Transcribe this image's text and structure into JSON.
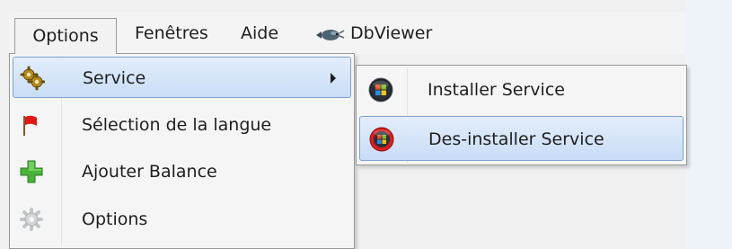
{
  "menubar": {
    "items": [
      {
        "label": "Options",
        "active": true
      },
      {
        "label": "Fenêtres"
      },
      {
        "label": "Aide"
      },
      {
        "label": "DbViewer",
        "icon": "fish-icon"
      }
    ]
  },
  "options_menu": {
    "items": [
      {
        "label": "Service",
        "icon": "gears-icon",
        "has_submenu": true,
        "highlighted": true
      },
      {
        "label": "Sélection de la langue",
        "icon": "red-flag-icon"
      },
      {
        "label": "Ajouter Balance",
        "icon": "green-plus-icon"
      },
      {
        "label": "Options",
        "icon": "gear-icon"
      }
    ]
  },
  "service_submenu": {
    "items": [
      {
        "label": "Installer Service",
        "icon": "windows-orb-icon"
      },
      {
        "label": "Des-installer Service",
        "icon": "windows-orb-red-icon",
        "highlighted": true
      }
    ]
  },
  "colors": {
    "highlight_border": "#7da2ce",
    "highlight_fill_top": "#e3eefc",
    "highlight_fill_bottom": "#c9dcf6",
    "menu_background": "#f5f5f5",
    "menu_border": "#979797"
  }
}
